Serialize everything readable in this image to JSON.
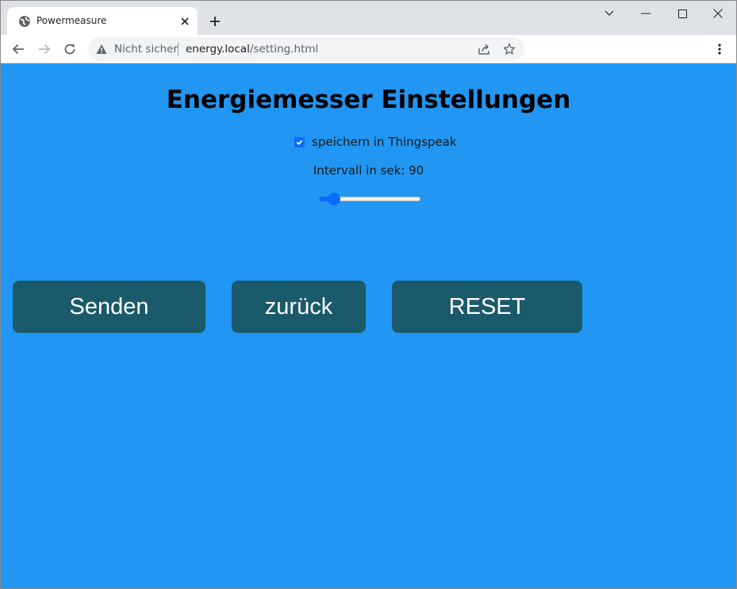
{
  "browser": {
    "tab_title": "Powermeasure",
    "not_secure_label": "Nicht sicher",
    "url_host": "energy.local",
    "url_path": "/setting.html"
  },
  "page": {
    "title": "Energiemesser Einstellungen",
    "thingspeak_label": "speichern in Thingspeak",
    "thingspeak_checked": true,
    "interval_label": "Intervall in sek: 90",
    "interval_slider_fraction": 0.1,
    "buttons": {
      "send": "Senden",
      "back": "zurück",
      "reset": "RESET"
    }
  },
  "colors": {
    "page_background": "#2196f3",
    "button_background": "#1a5a6b",
    "accent": "#0b6cfb"
  }
}
